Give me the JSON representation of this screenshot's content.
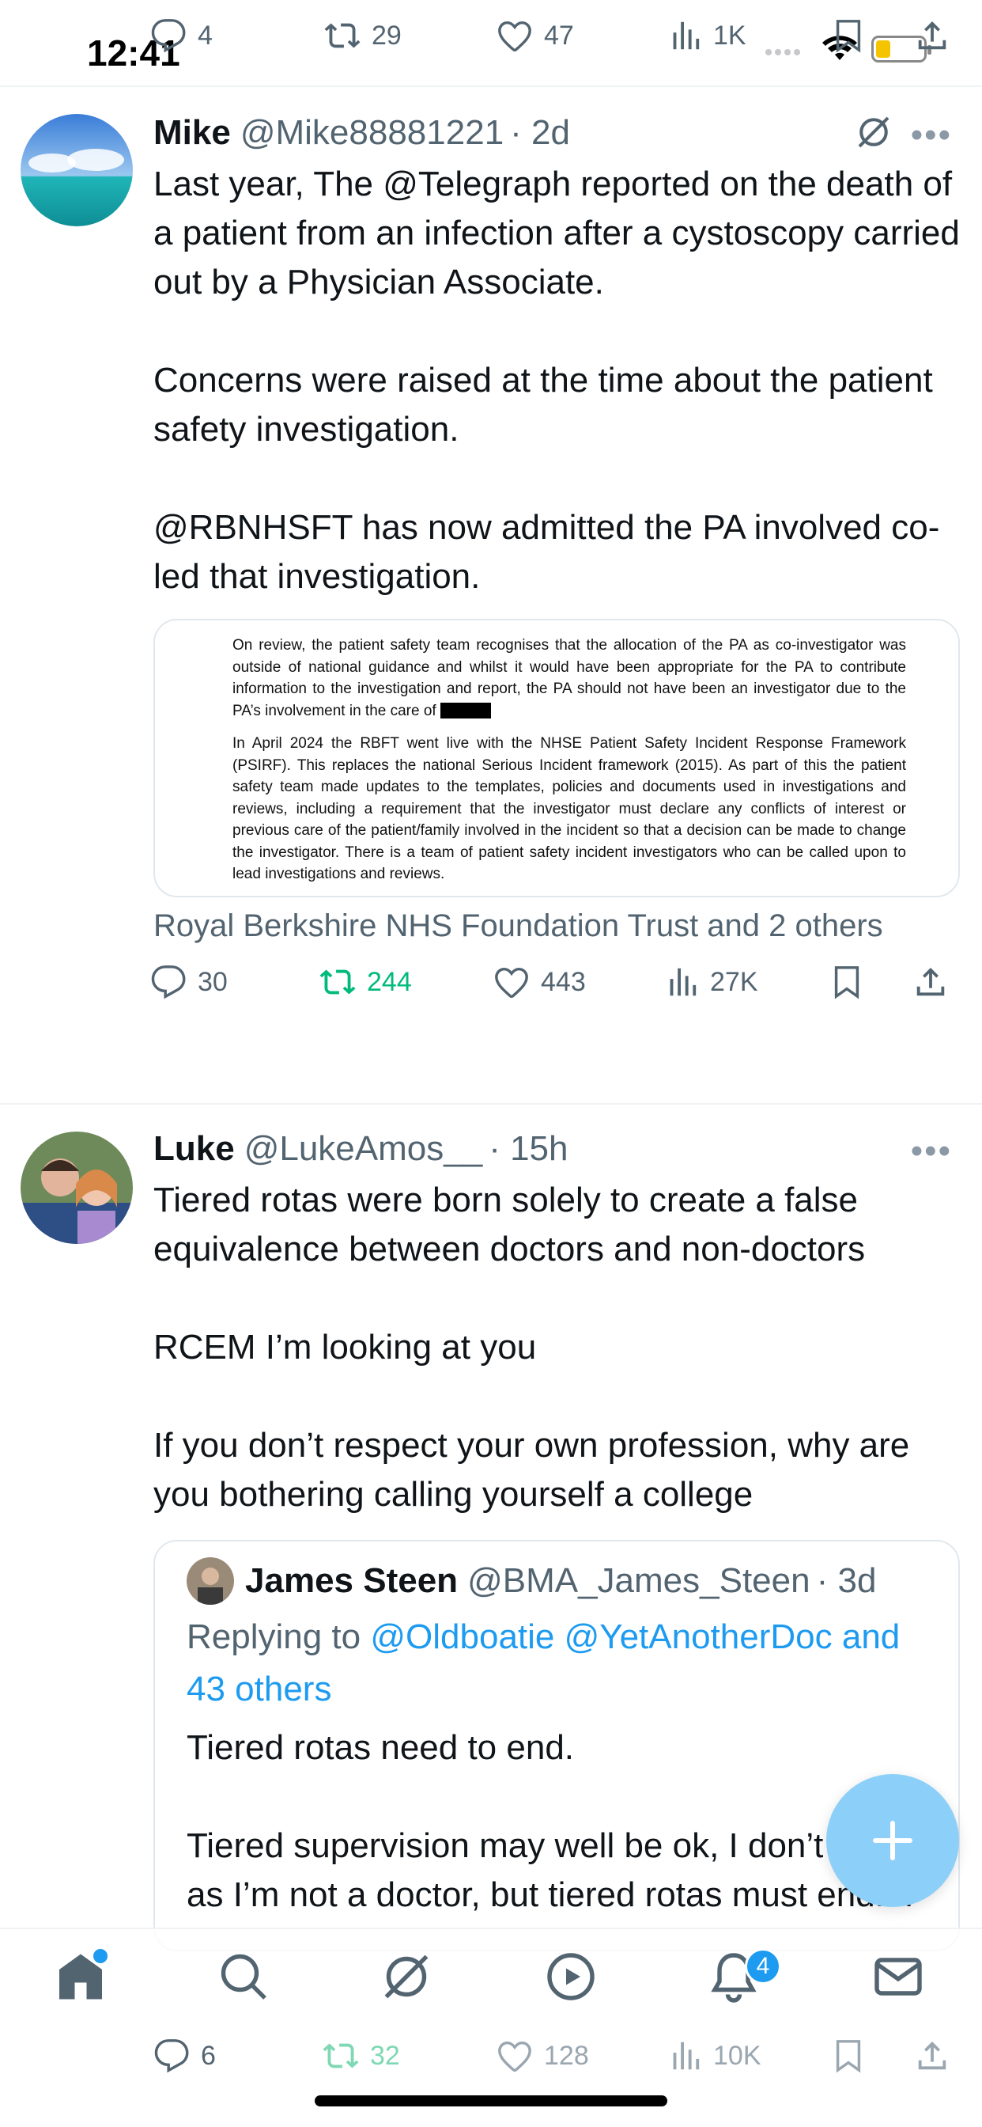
{
  "status_bar": {
    "time": "12:41"
  },
  "top_actions": {
    "replies": "4",
    "reposts": "29",
    "likes": "47",
    "views": "1K"
  },
  "tweets": [
    {
      "name": "Mike",
      "handle": "@Mike88881221",
      "time": "· 2d",
      "text": "Last year, The @Telegraph reported on the death of a patient from an infection after a cystoscopy carried out by a Physician Associate.\n\nConcerns were raised at the time about the patient safety investigation.\n\n@RBNHSFT has now admitted the PA involved co-led that investigation.",
      "document": {
        "para1": "On review, the patient safety team recognises that the allocation of the PA as co-investigator was outside of national guidance and whilst it would have been appropriate for the PA to contribute information to the investigation and report, the PA should not have been an investigator due to the PA’s involvement in the care of",
        "para2": "In April 2024 the RBFT went live with the NHSE Patient Safety Incident Response Framework (PSIRF). This replaces the national Serious Incident framework (2015). As part of this the patient safety team made updates to the templates, policies and documents used in investigations and reviews, including a requirement that the investigator must declare any conflicts of interest or previous care of the patient/family involved in the incident so that a decision can be made to change the investigator. There is a team of patient safety incident investigators who can be called upon to lead investigations and reviews."
      },
      "tagged": "Royal Berkshire NHS Foundation Trust and 2 others",
      "replies": "30",
      "reposts": "244",
      "likes": "443",
      "views": "27K",
      "reposted_color": "#00ba7c"
    },
    {
      "name": "Luke",
      "handle": "@LukeAmos__",
      "time": "· 15h",
      "text": "Tiered rotas were born solely to create a false equivalence between doctors and non-doctors\n\nRCEM I’m looking at you\n\nIf you don’t respect your own profession, why are you bothering calling yourself a college",
      "quote": {
        "name": "James Steen",
        "handle": "@BMA_James_Steen",
        "time": "· 3d",
        "replying_prefix": "Replying to ",
        "mentions": "@Oldboatie @YetAnotherDoc and 43 others",
        "text": "Tiered rotas need to end.\n\nTiered supervision may well be ok, I don’t know as I’m not a doctor, but tiered rotas must end...."
      },
      "replies": "6",
      "reposts": "32",
      "likes": "128",
      "views": "10K"
    }
  ],
  "tabbar": {
    "items": [
      "home-icon",
      "search-icon",
      "grok-icon",
      "video-icon",
      "notifications-icon",
      "messages-icon"
    ],
    "notification_count": "4"
  },
  "colors": {
    "accent": "#1d9bf0",
    "muted": "#536471",
    "repost_green": "#00ba7c"
  }
}
